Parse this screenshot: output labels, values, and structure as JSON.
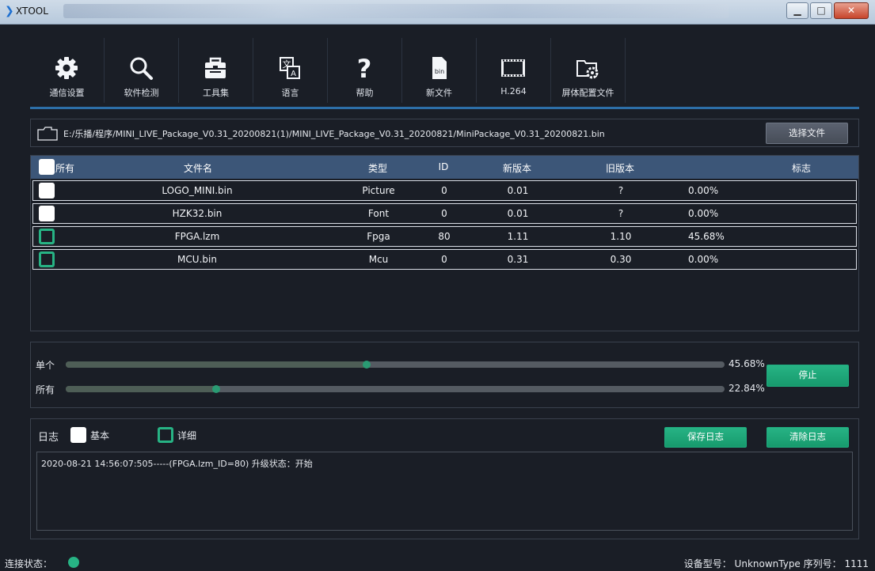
{
  "window": {
    "title": "XTOOL"
  },
  "toolbar": {
    "items": [
      {
        "label": "通信设置",
        "icon": "gear-icon"
      },
      {
        "label": "软件检测",
        "icon": "search-icon"
      },
      {
        "label": "工具集",
        "icon": "toolbox-icon"
      },
      {
        "label": "语言",
        "icon": "language-icon"
      },
      {
        "label": "帮助",
        "icon": "help-icon"
      },
      {
        "label": "新文件",
        "icon": "bin-file-icon"
      },
      {
        "label": "H.264",
        "icon": "film-icon"
      },
      {
        "label": "屏体配置文件",
        "icon": "folder-gear-icon"
      }
    ]
  },
  "file_path": {
    "path": "E:/乐播/程序/MINI_LIVE_Package_V0.31_20200821(1)/MINI_LIVE_Package_V0.31_20200821/MiniPackage_V0.31_20200821.bin",
    "select_button": "选择文件"
  },
  "table": {
    "headers": [
      "所有",
      "文件名",
      "类型",
      "ID",
      "新版本",
      "旧版本",
      "标志"
    ],
    "rows": [
      {
        "checked": false,
        "name": "LOGO_MINI.bin",
        "type": "Picture",
        "id": "0",
        "new_version": "0.01",
        "old_version": "?",
        "progress": "0.00%"
      },
      {
        "checked": false,
        "name": "HZK32.bin",
        "type": "Font",
        "id": "0",
        "new_version": "0.01",
        "old_version": "?",
        "progress": "0.00%"
      },
      {
        "checked": true,
        "name": "FPGA.lzm",
        "type": "Fpga",
        "id": "80",
        "new_version": "1.11",
        "old_version": "1.10",
        "progress": "45.68%"
      },
      {
        "checked": true,
        "name": "MCU.bin",
        "type": "Mcu",
        "id": "0",
        "new_version": "0.31",
        "old_version": "0.30",
        "progress": "0.00%"
      }
    ]
  },
  "progress": {
    "single_label": "单个",
    "single_value": "45.68%",
    "single_fraction": 0.4568,
    "all_label": "所有",
    "all_value": "22.84%",
    "all_fraction": 0.2284,
    "stop_button": "停止"
  },
  "log": {
    "title": "日志",
    "basic_label": "基本",
    "basic_checked": false,
    "detail_label": "详细",
    "detail_checked": true,
    "save_button": "保存日志",
    "clear_button": "清除日志",
    "lines": [
      "2020-08-21 14:56:07:505-----(FPGA.lzm_ID=80) 升级状态：开始"
    ]
  },
  "status": {
    "connection_label": "连接状态：",
    "connection_color": "#27b384",
    "device_info": "设备型号： UnknownType 序列号： 1111"
  },
  "colors": {
    "accent": "#27b384",
    "header_bg": "#3c5678",
    "background": "#1a1e26"
  }
}
